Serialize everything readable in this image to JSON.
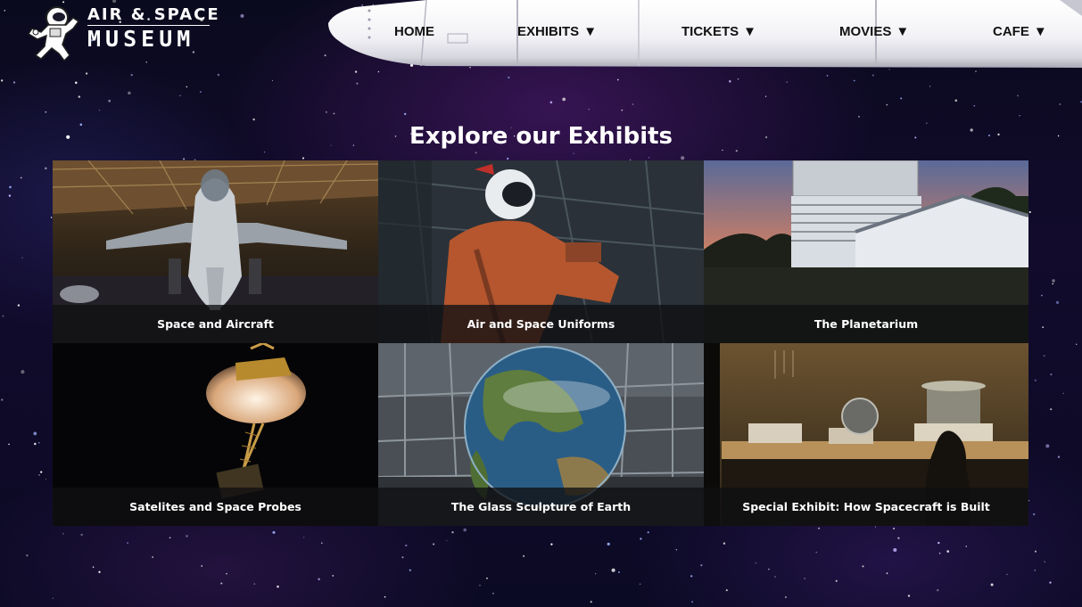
{
  "logo": {
    "line1": "AIR & SPACE",
    "line2": "MUSEUM",
    "icon": "astronaut-icon"
  },
  "nav": {
    "items": [
      {
        "label": "HOME",
        "has_dropdown": false
      },
      {
        "label": "EXHIBITS",
        "has_dropdown": true
      },
      {
        "label": "TICKETS",
        "has_dropdown": true
      },
      {
        "label": "MOVIES",
        "has_dropdown": true
      },
      {
        "label": "CAFE",
        "has_dropdown": true
      }
    ],
    "caret": "▼"
  },
  "main": {
    "title": "Explore our Exhibits",
    "exhibits": [
      {
        "label": "Space and Aircraft",
        "image": "fighter-jet-in-hangar"
      },
      {
        "label": "Air and Space Uniforms",
        "image": "astronaut-spacesuit"
      },
      {
        "label": "The Planetarium",
        "image": "planetarium-dome-at-sunset"
      },
      {
        "label": "Satelites and Space Probes",
        "image": "space-probe"
      },
      {
        "label": "The Glass Sculpture of Earth",
        "image": "glass-earth-globe"
      },
      {
        "label": "Special Exhibit: How Spacecraft is Built",
        "image": "museum-display-case"
      }
    ]
  }
}
